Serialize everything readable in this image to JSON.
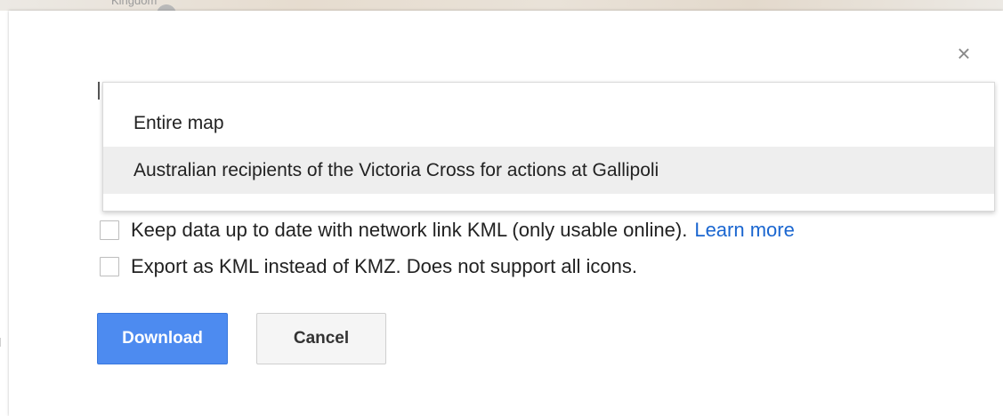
{
  "map": {
    "place_label": "Kingdom"
  },
  "dialog": {
    "close_symbol": "×",
    "dropdown": {
      "options": [
        {
          "label": "Entire map",
          "selected": false
        },
        {
          "label": "Australian recipients of the Victoria Cross for actions at Gallipoli",
          "selected": true
        }
      ]
    },
    "checkboxes": [
      {
        "label": "Keep data up to date with network link KML (only usable online).",
        "link": "Learn more",
        "checked": false
      },
      {
        "label": "Export as KML instead of KMZ. Does not support all icons.",
        "checked": false
      }
    ],
    "buttons": {
      "download": "Download",
      "cancel": "Cancel"
    }
  },
  "colors": {
    "primary_button": "#4d8bf0",
    "link": "#1a66d0",
    "selected_option_bg": "#eeeeee"
  }
}
